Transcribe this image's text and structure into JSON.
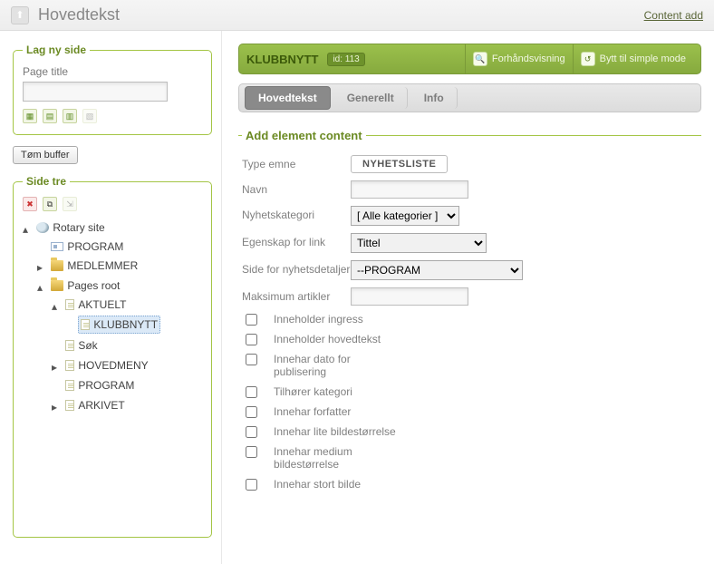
{
  "topbar": {
    "title": "Hovedtekst",
    "right_link": "Content add"
  },
  "sidebar": {
    "panel_new": {
      "legend": "Lag ny side",
      "page_title_label": "Page title"
    },
    "clear_buffer_label": "Tøm buffer",
    "panel_tree": {
      "legend": "Side tre",
      "root": "Rotary site",
      "items": {
        "program": "PROGRAM",
        "medlemmer": "MEDLEMMER",
        "pages_root": "Pages root",
        "aktuelt": "AKTUELT",
        "klubbnytt": "KLUBBNYTT",
        "sok": "Søk",
        "hovedmeny": "HOVEDMENY",
        "program2": "PROGRAM",
        "arkivet": "ARKIVET"
      }
    }
  },
  "content": {
    "page_name": "KLUBBNYTT",
    "id_label": "id: 113",
    "toolbar": {
      "preview": "Forhåndsvisning",
      "simple": "Bytt til simple mode"
    },
    "tabs": {
      "hovedtekst": "Hovedtekst",
      "generellt": "Generellt",
      "info": "Info"
    },
    "form": {
      "legend": "Add element content",
      "labels": {
        "type": "Type emne",
        "type_value": "NYHETSLISTE",
        "navn": "Navn",
        "kategori": "Nyhetskategori",
        "linkprop": "Egenskap for link",
        "side": "Side for nyhetsdetaljer",
        "max": "Maksimum artikler"
      },
      "selects": {
        "kategori": "[ Alle kategorier ]",
        "linkprop": "Tittel",
        "side": "--PROGRAM"
      },
      "checks": [
        "Inneholder ingress",
        "Inneholder hovedtekst",
        "Innehar dato for publisering",
        "Tilhører kategori",
        "Innehar forfatter",
        "Innehar lite bildestørrelse",
        "Innehar medium bildestørrelse",
        "Innehar stort bilde"
      ]
    }
  }
}
